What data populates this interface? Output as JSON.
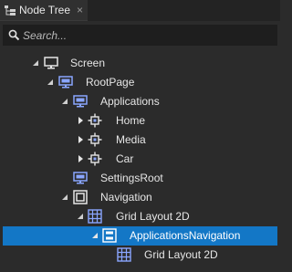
{
  "tab": {
    "title": "Node Tree",
    "close": "×",
    "icon": "node-tree-icon"
  },
  "search": {
    "placeholder": "Search...",
    "value": ""
  },
  "tree": {
    "nodes": [
      {
        "label": "Screen",
        "icon": "screen-icon",
        "expanded": true
      },
      {
        "label": "RootPage",
        "icon": "page-icon",
        "expanded": true
      },
      {
        "label": "Applications",
        "icon": "page-icon",
        "expanded": true
      },
      {
        "label": "Home",
        "icon": "component-icon",
        "expanded": false
      },
      {
        "label": "Media",
        "icon": "component-icon",
        "expanded": false
      },
      {
        "label": "Car",
        "icon": "component-icon",
        "expanded": false
      },
      {
        "label": "SettingsRoot",
        "icon": "page-icon",
        "expanded": null
      },
      {
        "label": "Navigation",
        "icon": "page-host-icon",
        "expanded": true
      },
      {
        "label": "Grid Layout 2D",
        "icon": "grid-layout-icon",
        "expanded": true
      },
      {
        "label": "ApplicationsNavigation",
        "icon": "list-layout-icon",
        "expanded": true,
        "selected": true
      },
      {
        "label": "Grid Layout 2D",
        "icon": "grid-layout-icon",
        "expanded": null
      }
    ]
  },
  "colors": {
    "background": "#2b2b2b",
    "selection": "#1377c6",
    "icon_blue": "#8aa6ff",
    "text": "#e6e6e6"
  }
}
